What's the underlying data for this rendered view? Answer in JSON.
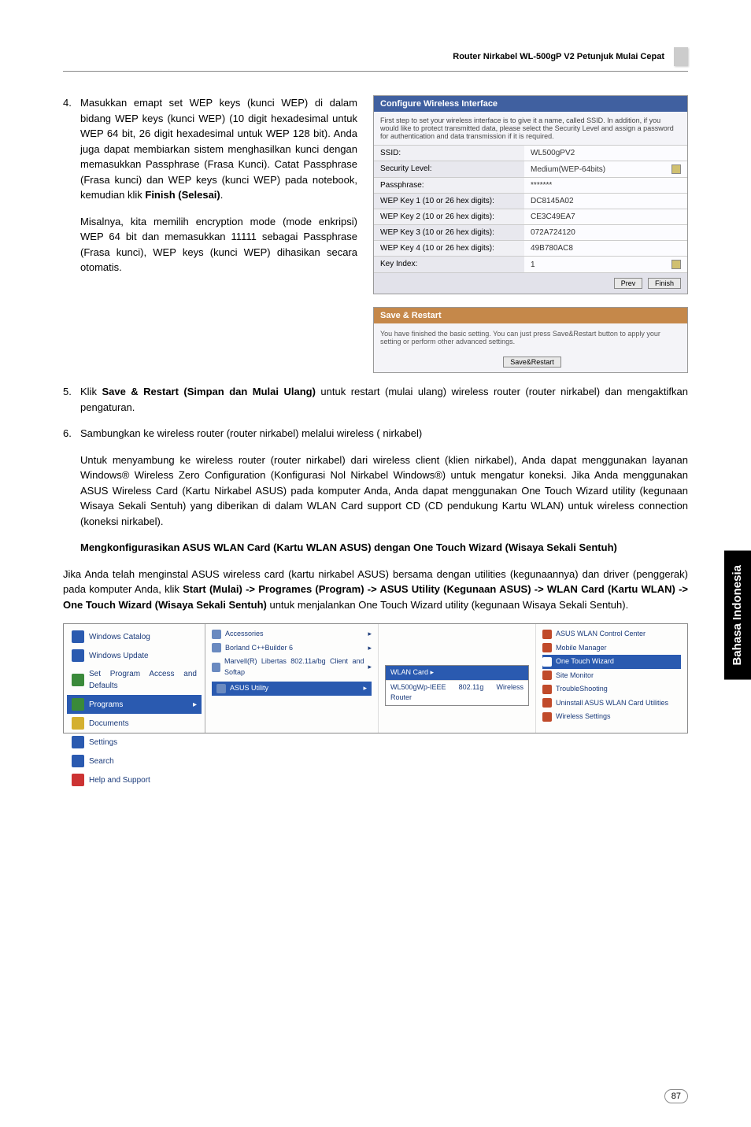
{
  "header": {
    "title": "Router Nirkabel WL-500gP V2    Petunjuk Mulai Cepat"
  },
  "step4": {
    "num": "4.",
    "text1": "Masukkan emapt set WEP keys (kunci WEP) di dalam bidang WEP keys (kunci WEP) (10 digit hexadesimal untuk WEP 64 bit, 26 digit hexadesimal untuk WEP 128 bit). Anda juga dapat membiarkan sistem menghasilkan kunci dengan memasukkan Passphrase (Frasa Kunci). Catat Passphrase (Frasa kunci) dan WEP keys (kunci WEP) pada notebook, kemudian klik ",
    "text1b": "Finish (Selesai)",
    "text1c": ".",
    "text2": "Misalnya, kita memilih encryption mode (mode enkripsi) WEP 64 bit dan memasukkan 11111 sebagai Passphrase (Frasa kunci), WEP keys (kunci WEP) dihasikan secara otomatis."
  },
  "panel1": {
    "title": "Configure Wireless Interface",
    "note": "First step to set your wireless interface is to give it a name, called SSID. In addition, if you would like to protect transmitted data, please select the Security Level and assign a password for authentication and data transmission if it is required.",
    "rows": [
      {
        "label": "SSID:",
        "value": "WL500gPV2"
      },
      {
        "label": "Security Level:",
        "value": "Medium(WEP-64bits)",
        "select": true
      },
      {
        "label": "Passphrase:",
        "value": "*******"
      },
      {
        "label": "WEP Key 1 (10 or 26 hex digits):",
        "value": "DC8145A02"
      },
      {
        "label": "WEP Key 2 (10 or 26 hex digits):",
        "value": "CE3C49EA7"
      },
      {
        "label": "WEP Key 3 (10 or 26 hex digits):",
        "value": "072A724120"
      },
      {
        "label": "WEP Key 4 (10 or 26 hex digits):",
        "value": "49B780AC8"
      },
      {
        "label": "Key Index:",
        "value": "1",
        "select": true
      }
    ],
    "btn_prev": "Prev",
    "btn_finish": "Finish"
  },
  "panel2": {
    "title": "Save & Restart",
    "body": "You have finished the basic setting. You can just press Save&Restart button to apply your setting or perform other advanced settings.",
    "btn": "Save&Restart"
  },
  "step5": {
    "num": "5.",
    "text_a": "Klik ",
    "text_b": "Save & Restart (Simpan dan Mulai Ulang)",
    "text_c": " untuk restart (mulai ulang) wireless router (router nirkabel) dan mengaktifkan pengaturan."
  },
  "step6": {
    "num": "6.",
    "text": "Sambungkan ke wireless router (router nirkabel) melalui wireless ( nirkabel)"
  },
  "para1": "Untuk menyambung ke wireless router (router nirkabel) dari wireless client (klien nirkabel), Anda dapat menggunakan layanan Windows® Wireless Zero Configuration (Konfigurasi Nol Nirkabel Windows®) untuk mengatur koneksi. Jika Anda menggunakan ASUS Wireless Card (Kartu Nirkabel ASUS) pada komputer Anda, Anda dapat menggunakan One Touch Wizard utility (kegunaan Wisaya Sekali Sentuh) yang diberikan di dalam WLAN Card support CD (CD pendukung Kartu WLAN) untuk wireless connection (koneksi nirkabel).",
  "heading2": "Mengkonfigurasikan ASUS WLAN Card (Kartu WLAN ASUS) dengan One Touch Wizard (Wisaya Sekali Sentuh)",
  "para2_a": "Jika Anda telah menginstal ASUS wireless card (kartu nirkabel ASUS) bersama dengan utilities (kegunaannya) dan driver (penggerak) pada komputer Anda, klik ",
  "para2_b": "Start (Mulai) -> Programes (Program) -> ASUS Utility (Kegunaan ASUS) -> WLAN Card (Kartu WLAN) -> One Touch Wizard (Wisaya Sekali Sentuh)",
  "para2_c": " untuk menjalankan One Touch Wizard utility (kegunaan Wisaya Sekali Sentuh).",
  "start_menu": {
    "left": [
      {
        "label": "Windows Catalog",
        "ico": "b"
      },
      {
        "label": "Windows Update",
        "ico": "b"
      },
      {
        "label": "Set Program Access and Defaults",
        "ico": "g"
      },
      {
        "label": "Programs",
        "ico": "g",
        "hl": true
      },
      {
        "label": "Documents",
        "ico": "y"
      },
      {
        "label": "Settings",
        "ico": "b"
      },
      {
        "label": "Search",
        "ico": "b"
      },
      {
        "label": "Help and Support",
        "ico": "r"
      }
    ],
    "col1": [
      "Accessories",
      "Borland C++Builder 6",
      "Marvell(R) Libertas 802.11a/bg Client and Softap"
    ],
    "col1_hl": "ASUS Utility",
    "col2_hdr": "WLAN Card",
    "col2_row": "WL500gWp-IEEE 802.11g Wireless Router",
    "col3": [
      "ASUS WLAN Control Center",
      "Mobile Manager",
      "One Touch Wizard",
      "Site Monitor",
      "TroubleShooting",
      "Uninstall ASUS WLAN Card Utilities",
      "Wireless Settings"
    ]
  },
  "side_tab": "Bahasa Indonesia",
  "page_num": "87"
}
